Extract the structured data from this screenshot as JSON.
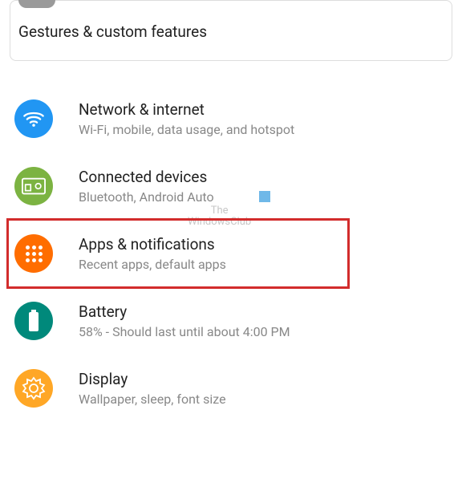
{
  "card": {
    "title": "Gestures & custom features"
  },
  "watermark": {
    "line1": "The",
    "line2": "WindowsClub"
  },
  "items": {
    "network": {
      "title": "Network & internet",
      "subtitle": "Wi-Fi, mobile, data usage, and hotspot"
    },
    "connected": {
      "title": "Connected devices",
      "subtitle": "Bluetooth, Android Auto"
    },
    "apps": {
      "title": "Apps & notifications",
      "subtitle": "Recent apps, default apps"
    },
    "battery": {
      "title": "Battery",
      "subtitle": "58% - Should last until about 4:00 PM"
    },
    "display": {
      "title": "Display",
      "subtitle": "Wallpaper, sleep, font size"
    }
  }
}
